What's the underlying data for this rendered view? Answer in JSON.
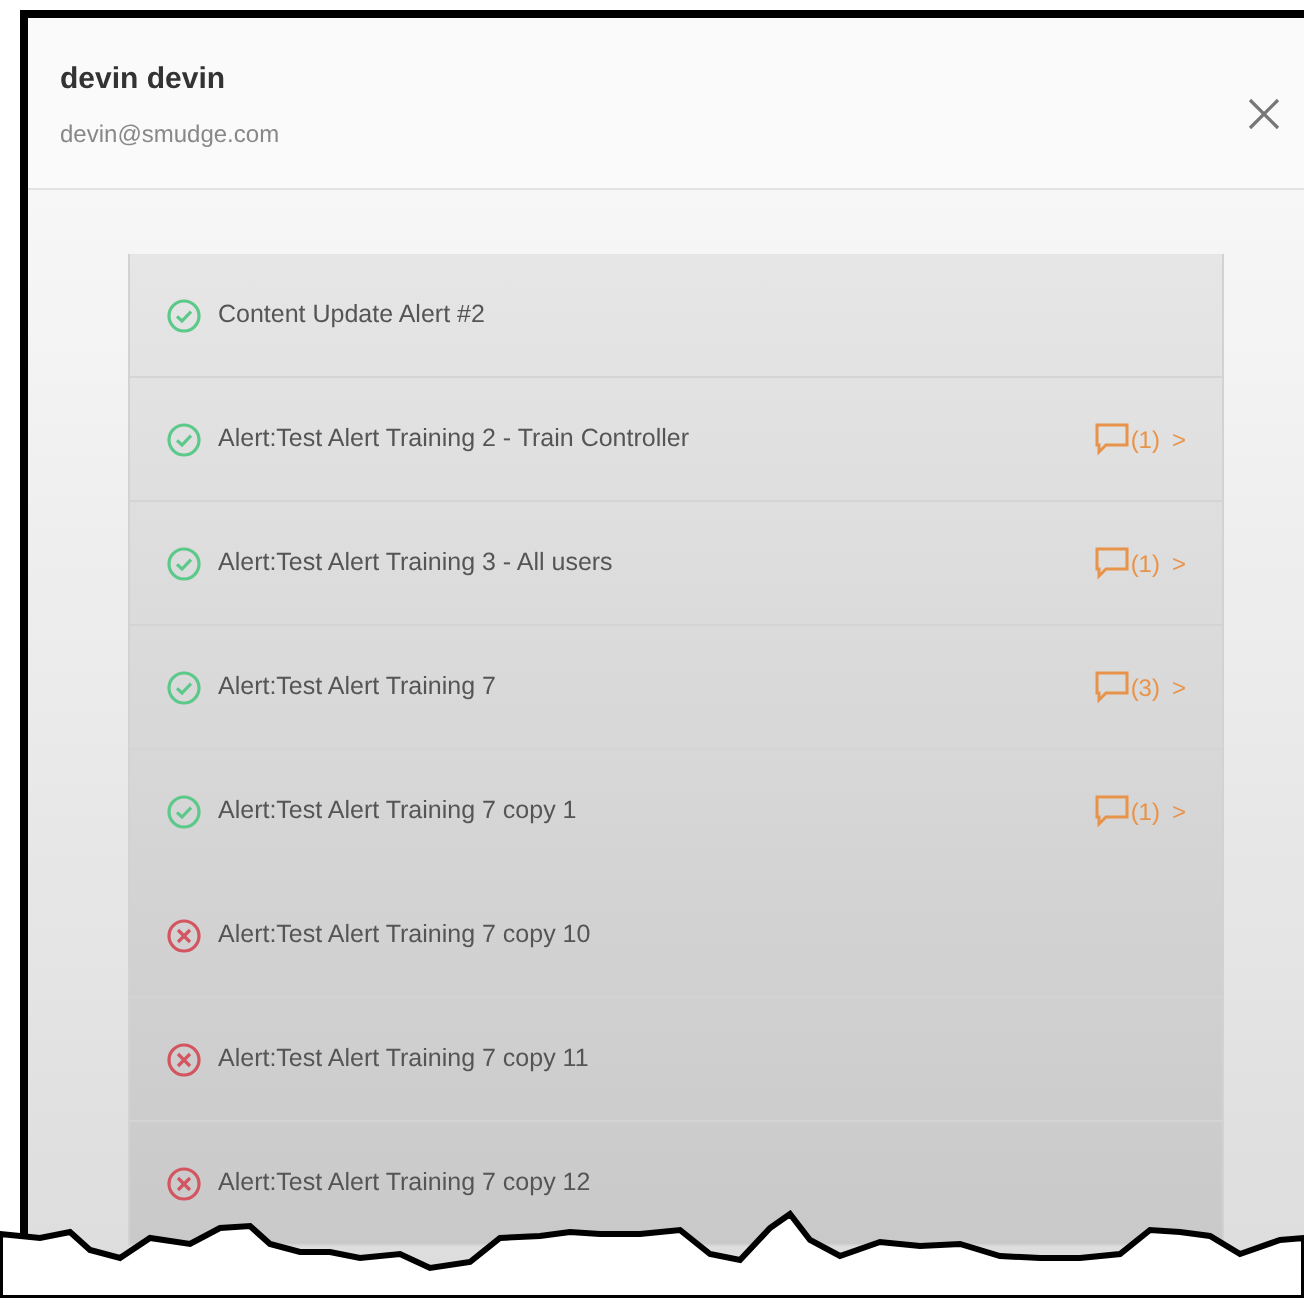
{
  "user": {
    "name": "devin devin",
    "email": "devin@smudge.com"
  },
  "alerts": [
    {
      "completed": true,
      "title": "Content Update Alert #2"
    },
    {
      "completed": true,
      "title": "Alert:Test Alert Training 2 - Train Controller",
      "comments": "(1)",
      "arrow": ">"
    },
    {
      "completed": true,
      "title": "Alert:Test Alert Training 3 - All users",
      "comments": "(1)",
      "arrow": ">"
    },
    {
      "completed": true,
      "title": "Alert:Test Alert Training 7",
      "comments": "(3)",
      "arrow": ">"
    },
    {
      "completed": true,
      "title": "Alert:Test Alert Training 7 copy 1",
      "comments": "(1)",
      "arrow": ">"
    },
    {
      "completed": false,
      "title": "Alert:Test Alert Training 7 copy 10"
    },
    {
      "completed": false,
      "title": "Alert:Test Alert Training 7 copy 11"
    },
    {
      "completed": false,
      "title": "Alert:Test Alert Training 7 copy 12"
    }
  ]
}
